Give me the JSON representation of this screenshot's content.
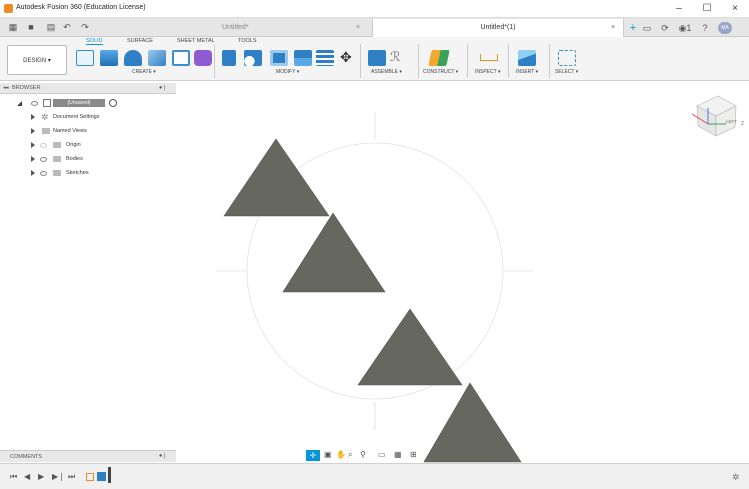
{
  "window": {
    "title": "Autodesk Fusion 360 (Education License)"
  },
  "tabs": [
    {
      "label": "Untitled*"
    },
    {
      "label": "Untitled*(1)"
    }
  ],
  "user": {
    "initials": "MA",
    "job_count": "1"
  },
  "ribbon": {
    "tabs": [
      "SOLID",
      "SURFACE",
      "SHEET METAL",
      "TOOLS"
    ],
    "active_tab": "SOLID",
    "workspace": "DESIGN ▾",
    "groups": [
      "CREATE ▾",
      "MODIFY ▾",
      "ASSEMBLE ▾",
      "CONSTRUCT ▾",
      "INSPECT ▾",
      "INSERT ▾",
      "SELECT ▾"
    ]
  },
  "browser": {
    "title": "BROWSER",
    "root": "(Unsaved)",
    "items": [
      "Document Settings",
      "Named Views",
      "Origin",
      "Bodies",
      "Sketches"
    ]
  },
  "viewcube": {
    "face": "LEFT",
    "axis_z": "Z"
  },
  "comments": {
    "label": "COMMENTS"
  },
  "colors": {
    "accent": "#0696d7",
    "body": "#66675f",
    "ribbon_bg": "#f4f4f4",
    "orange": "#f08a24"
  }
}
